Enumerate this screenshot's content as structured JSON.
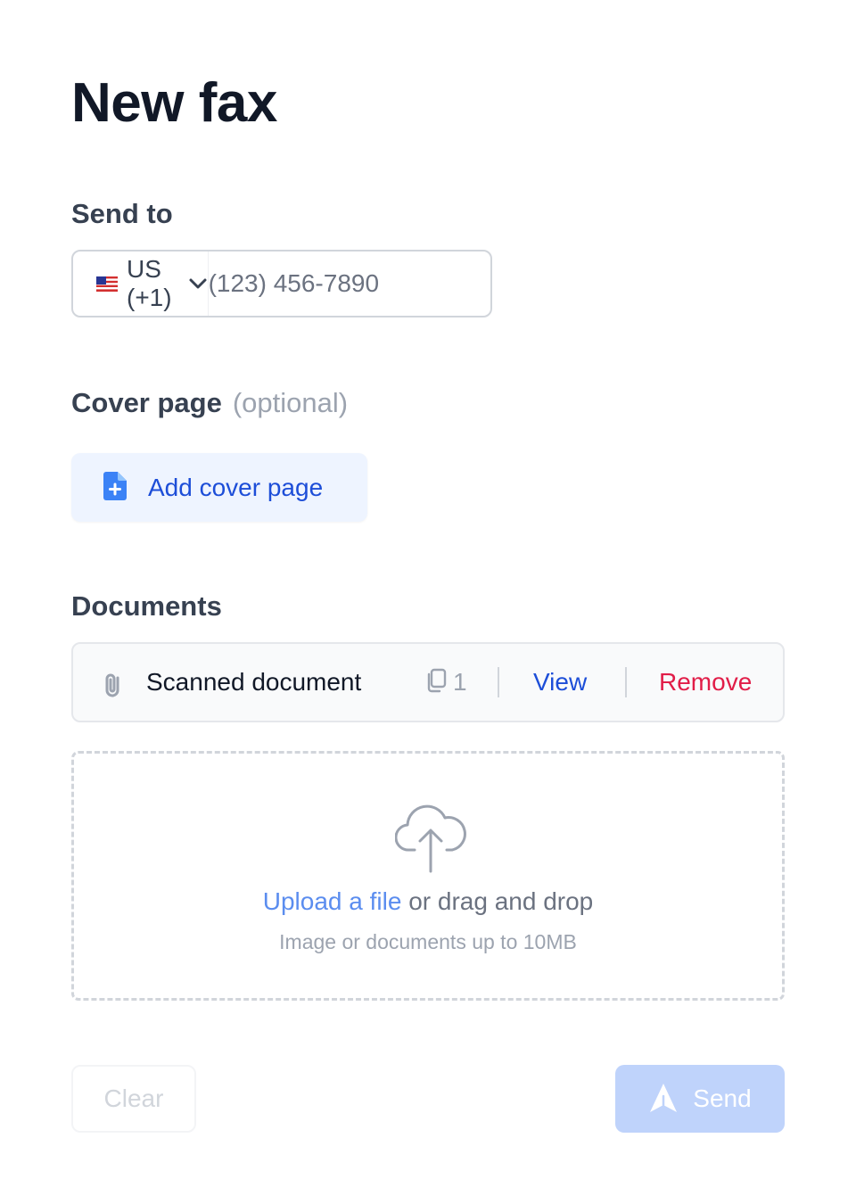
{
  "page": {
    "title": "New fax"
  },
  "send_to": {
    "label": "Send to",
    "country": {
      "flag": "us-flag-icon",
      "label": "US (+1)"
    },
    "phone_placeholder": "(123) 456-7890",
    "phone_value": ""
  },
  "cover_page": {
    "label": "Cover page",
    "optional_text": "(optional)",
    "add_button_label": "Add cover page",
    "add_button_icon": "document-plus-icon"
  },
  "documents": {
    "label": "Documents",
    "items": [
      {
        "name": "Scanned document",
        "icon": "paperclip-icon",
        "page_count": "1",
        "view_label": "View",
        "remove_label": "Remove"
      }
    ],
    "upload": {
      "icon": "cloud-upload-icon",
      "link_text": "Upload a file",
      "rest_text": " or drag and drop",
      "hint": "Image or documents up to 10MB"
    }
  },
  "actions": {
    "clear_label": "Clear",
    "send_label": "Send",
    "send_icon": "send-arrow-icon"
  },
  "colors": {
    "title": "#111827",
    "accent_blue": "#1d4ed8",
    "remove_red": "#e11d48",
    "cover_bg": "#eef4ff",
    "send_bg_disabled": "#bfd3fb"
  }
}
